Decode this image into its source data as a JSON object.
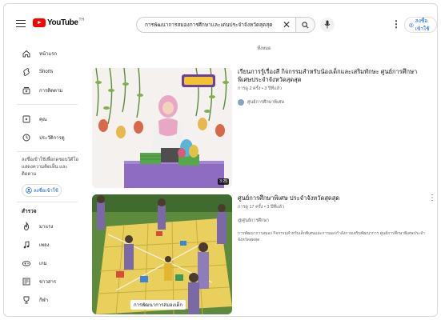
{
  "header": {
    "logo_text": "YouTube",
    "logo_country": "TH",
    "search_value": "การพัฒนาการสมองการศึกษาและเด่นประจำจังหวัดสุดสุด",
    "signin_label": "ลงชื่อเข้าใช้"
  },
  "chips": {
    "label": "ทั้งหมด"
  },
  "sidebar": {
    "items": [
      {
        "label": "หน้าแรก",
        "icon": "home-icon"
      },
      {
        "label": "Shorts",
        "icon": "shorts-icon"
      },
      {
        "label": "การติดตาม",
        "icon": "subscriptions-icon"
      }
    ],
    "items2": [
      {
        "label": "คุณ",
        "icon": "library-icon"
      },
      {
        "label": "ประวัติการดู",
        "icon": "history-icon"
      }
    ],
    "signin_prompt": "ลงชื่อเข้าใช้เพื่อกดชอบวิดีโอ แสดงความคิดเห็น และติดตาม",
    "signin_label": "ลงชื่อเข้าใช้",
    "explore_heading": "สำรวจ",
    "explore": [
      {
        "label": "มาแรง",
        "icon": "trending-icon"
      },
      {
        "label": "เพลง",
        "icon": "music-icon"
      },
      {
        "label": "เกม",
        "icon": "gaming-icon"
      },
      {
        "label": "ข่าวสาร",
        "icon": "news-icon"
      },
      {
        "label": "กีฬา",
        "icon": "sports-icon"
      }
    ]
  },
  "results": [
    {
      "title": "เรียนการรู้เรื่องสี กิจกรรมสำหรับน้องเด็กและเสริมทักษะ ศูนย์การศึกษาพิเศษประจำจังหวัดสุดสุด",
      "info": "การดู 2 ครั้ง • 3 ปีที่แล้ว",
      "channel": "ศูนย์การศึกษาพิเศษ",
      "duration": "3:25",
      "description": ""
    },
    {
      "title": "ศูนย์การศึกษาพิเศษ ประจำจังหวัดสุดสุด",
      "info": "การดู 17 ครั้ง • 3 ปีที่แล้ว",
      "channel": "@ศูนย์การศึกษา",
      "duration": "",
      "description": "การพัฒนาการสมอง กิจกรรมสำหรับเด็กพิเศษและการออกกำลังกายเสริมพัฒนาการ ศูนย์การศึกษาพิเศษประจำจังหวัดสุดสุด",
      "caption": "การพัฒนาการสมองเด็ก"
    }
  ]
}
